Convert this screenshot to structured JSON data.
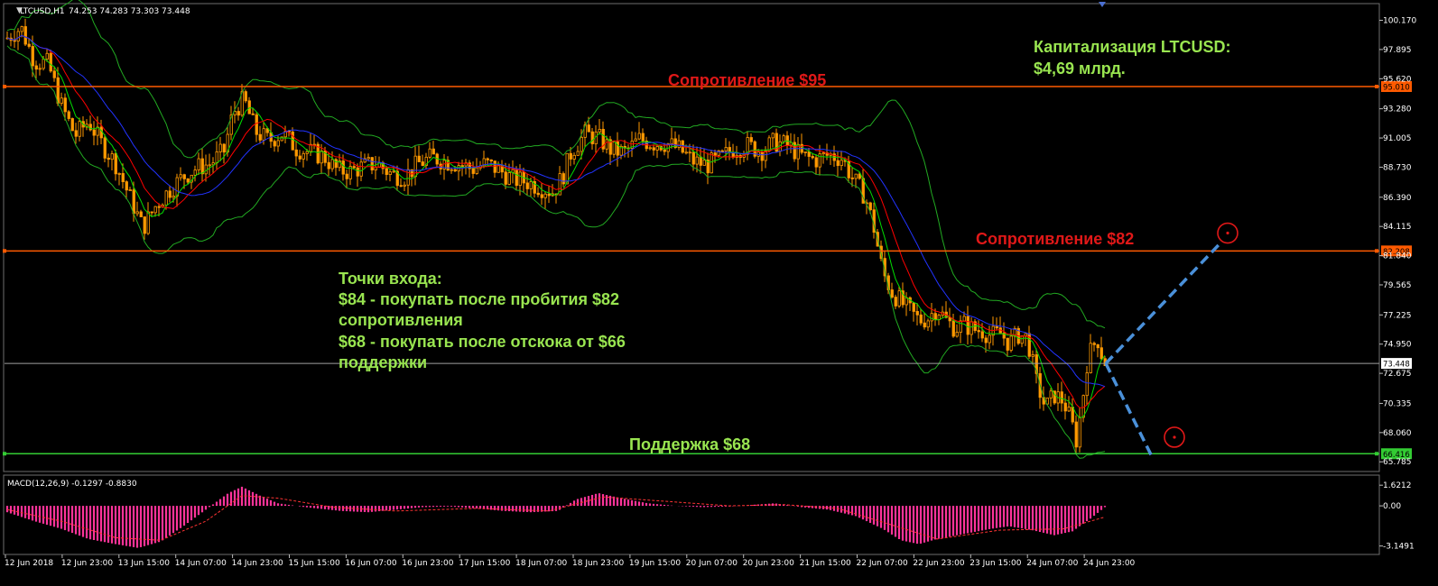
{
  "header": {
    "symbol": "LTCUSD,H1",
    "ohlc": "74.253 74.283 73.303 73.448"
  },
  "macd_header": {
    "label": "MACD(12,26,9) -0.1297 -0.8830"
  },
  "colors": {
    "background": "#000000",
    "candle": "#ff9900",
    "resistance_line": "#ff5a00",
    "support_line": "#33cc33",
    "price_line": "#a0a0a0",
    "bollinger": "#22aa22",
    "ma_fast": "#00dd00",
    "ma_red": "#ff0000",
    "ma_blue": "#2233ff",
    "macd_hist": "#ff3399",
    "macd_signal": "#ff3333",
    "projection": "#4a90d9",
    "annotation_green": "#99e550",
    "annotation_red": "#e01818"
  },
  "chart_data": {
    "type": "candlestick",
    "title": "",
    "y_ticks": [
      "100.170",
      "97.895",
      "95.620",
      "93.280",
      "91.005",
      "88.730",
      "86.390",
      "84.115",
      "81.840",
      "79.565",
      "77.225",
      "74.950",
      "72.675",
      "70.335",
      "68.060",
      "65.785"
    ],
    "x_ticks": [
      "12 Jun 2018",
      "12 Jun 23:00",
      "13 Jun 15:00",
      "14 Jun 07:00",
      "14 Jun 23:00",
      "15 Jun 15:00",
      "16 Jun 07:00",
      "16 Jun 23:00",
      "17 Jun 15:00",
      "18 Jun 07:00",
      "18 Jun 23:00",
      "19 Jun 15:00",
      "20 Jun 07:00",
      "20 Jun 23:00",
      "21 Jun 15:00",
      "22 Jun 07:00",
      "22 Jun 23:00",
      "23 Jun 15:00",
      "24 Jun 07:00",
      "24 Jun 23:00"
    ],
    "ylim": [
      65.1,
      101.4
    ],
    "levels": [
      {
        "name": "resistance-95",
        "value": 95.01,
        "label": "95.010"
      },
      {
        "name": "resistance-82",
        "value": 82.208,
        "label": "82.208"
      },
      {
        "name": "current-price",
        "value": 73.448,
        "label": "73.448"
      },
      {
        "name": "support-66",
        "value": 66.416,
        "label": "66.416"
      }
    ],
    "price_path": [
      [
        0,
        98.8
      ],
      [
        15,
        99.6
      ],
      [
        30,
        97.0
      ],
      [
        45,
        96.8
      ],
      [
        60,
        93.5
      ],
      [
        75,
        91.2
      ],
      [
        90,
        92.3
      ],
      [
        105,
        90.5
      ],
      [
        120,
        89.0
      ],
      [
        135,
        86.5
      ],
      [
        150,
        84.0
      ],
      [
        165,
        85.8
      ],
      [
        180,
        87.0
      ],
      [
        195,
        88.0
      ],
      [
        210,
        88.7
      ],
      [
        225,
        89.0
      ],
      [
        240,
        90.0
      ],
      [
        250,
        93.0
      ],
      [
        262,
        94.0
      ],
      [
        275,
        91.5
      ],
      [
        290,
        90.8
      ],
      [
        305,
        91.4
      ],
      [
        320,
        90.2
      ],
      [
        335,
        89.9
      ],
      [
        350,
        89.6
      ],
      [
        365,
        88.5
      ],
      [
        380,
        88.4
      ],
      [
        395,
        88.8
      ],
      [
        410,
        89.0
      ],
      [
        425,
        88.2
      ],
      [
        440,
        88.0
      ],
      [
        455,
        89.0
      ],
      [
        470,
        89.5
      ],
      [
        485,
        89.2
      ],
      [
        500,
        89.0
      ],
      [
        515,
        88.6
      ],
      [
        530,
        89.0
      ],
      [
        545,
        88.5
      ],
      [
        560,
        87.8
      ],
      [
        575,
        87.6
      ],
      [
        590,
        87.2
      ],
      [
        605,
        86.8
      ],
      [
        615,
        88.0
      ],
      [
        625,
        90.0
      ],
      [
        640,
        91.3
      ],
      [
        655,
        91.0
      ],
      [
        670,
        90.0
      ],
      [
        685,
        89.9
      ],
      [
        700,
        90.9
      ],
      [
        715,
        90.6
      ],
      [
        730,
        90.6
      ],
      [
        745,
        90.1
      ],
      [
        760,
        89.2
      ],
      [
        775,
        88.9
      ],
      [
        790,
        89.4
      ],
      [
        805,
        90.2
      ],
      [
        820,
        90.4
      ],
      [
        835,
        90.0
      ],
      [
        850,
        90.7
      ],
      [
        865,
        90.4
      ],
      [
        880,
        89.6
      ],
      [
        895,
        89.3
      ],
      [
        910,
        89.7
      ],
      [
        925,
        89.4
      ],
      [
        935,
        88.0
      ],
      [
        950,
        86.5
      ],
      [
        960,
        84.0
      ],
      [
        970,
        80.5
      ],
      [
        980,
        79.0
      ],
      [
        990,
        78.2
      ],
      [
        1000,
        77.5
      ],
      [
        1010,
        76.8
      ],
      [
        1020,
        77.0
      ],
      [
        1030,
        77.8
      ],
      [
        1040,
        76.8
      ],
      [
        1050,
        76.2
      ],
      [
        1060,
        76.5
      ],
      [
        1070,
        76.1
      ],
      [
        1080,
        76.0
      ],
      [
        1090,
        75.6
      ],
      [
        1100,
        75.8
      ],
      [
        1110,
        75.0
      ],
      [
        1120,
        75.7
      ],
      [
        1130,
        75.4
      ],
      [
        1140,
        72.0
      ],
      [
        1150,
        70.0
      ],
      [
        1160,
        71.0
      ],
      [
        1170,
        70.5
      ],
      [
        1178,
        69.0
      ],
      [
        1184,
        67.5
      ],
      [
        1190,
        70.0
      ],
      [
        1196,
        73.5
      ],
      [
        1202,
        74.8
      ],
      [
        1208,
        75.3
      ],
      [
        1214,
        73.7
      ],
      [
        1219,
        73.448
      ]
    ],
    "projections": [
      {
        "name": "bullish",
        "from": {
          "x": 1219,
          "y": 73.448
        },
        "to": {
          "x": 1347,
          "y": 82.9
        }
      },
      {
        "name": "bearish",
        "from": {
          "x": 1219,
          "y": 73.448
        },
        "to": {
          "x": 1270,
          "y": 66.2
        }
      }
    ],
    "targets": [
      {
        "name": "target-up",
        "x": 1354,
        "y": 83.6
      },
      {
        "name": "target-down",
        "x": 1295,
        "y": 67.7
      }
    ],
    "macd": {
      "ylim": [
        -3.6,
        2.2
      ],
      "ticks": [
        "1.6212",
        "0.00",
        "-3.1491"
      ],
      "hist_path": [
        [
          0,
          -0.5
        ],
        [
          30,
          -1.2
        ],
        [
          60,
          -1.8
        ],
        [
          90,
          -2.6
        ],
        [
          120,
          -3.0
        ],
        [
          145,
          -3.3
        ],
        [
          170,
          -2.8
        ],
        [
          195,
          -1.6
        ],
        [
          220,
          -0.3
        ],
        [
          245,
          1.0
        ],
        [
          260,
          1.5
        ],
        [
          280,
          0.8
        ],
        [
          300,
          0.2
        ],
        [
          330,
          -0.1
        ],
        [
          370,
          -0.4
        ],
        [
          400,
          -0.5
        ],
        [
          430,
          -0.3
        ],
        [
          460,
          -0.1
        ],
        [
          490,
          -0.05
        ],
        [
          520,
          -0.2
        ],
        [
          550,
          -0.4
        ],
        [
          580,
          -0.5
        ],
        [
          610,
          -0.4
        ],
        [
          630,
          0.5
        ],
        [
          655,
          1.0
        ],
        [
          680,
          0.6
        ],
        [
          710,
          0.2
        ],
        [
          740,
          0.0
        ],
        [
          770,
          -0.1
        ],
        [
          800,
          -0.05
        ],
        [
          830,
          0.1
        ],
        [
          850,
          0.2
        ],
        [
          880,
          -0.1
        ],
        [
          910,
          -0.3
        ],
        [
          940,
          -0.8
        ],
        [
          970,
          -1.8
        ],
        [
          990,
          -2.7
        ],
        [
          1010,
          -3.0
        ],
        [
          1030,
          -2.6
        ],
        [
          1060,
          -2.2
        ],
        [
          1090,
          -1.8
        ],
        [
          1110,
          -1.6
        ],
        [
          1135,
          -1.9
        ],
        [
          1160,
          -2.3
        ],
        [
          1180,
          -2.0
        ],
        [
          1200,
          -1.0
        ],
        [
          1216,
          -0.1
        ]
      ],
      "signal_path": [
        [
          0,
          -0.3
        ],
        [
          60,
          -1.2
        ],
        [
          120,
          -2.5
        ],
        [
          170,
          -2.7
        ],
        [
          220,
          -1.2
        ],
        [
          260,
          0.8
        ],
        [
          300,
          0.6
        ],
        [
          360,
          -0.1
        ],
        [
          430,
          -0.4
        ],
        [
          520,
          -0.2
        ],
        [
          600,
          -0.4
        ],
        [
          660,
          0.7
        ],
        [
          720,
          0.4
        ],
        [
          800,
          0.0
        ],
        [
          860,
          0.1
        ],
        [
          920,
          -0.2
        ],
        [
          980,
          -1.5
        ],
        [
          1030,
          -2.6
        ],
        [
          1100,
          -1.9
        ],
        [
          1170,
          -1.8
        ],
        [
          1216,
          -0.88
        ]
      ]
    }
  },
  "annotations": {
    "capitalization": [
      "Капитализация LTCUSD:",
      "$4,69 млрд."
    ],
    "resistance_95": "Сопротивление $95",
    "resistance_82": "Сопротивление $82",
    "support_68": "Поддержка $68",
    "entry_points": [
      "Точки входа:",
      "$84 - покупать после пробития $82",
      "сопротивления",
      "$68 - покупать после отскока от $66",
      "поддержки"
    ]
  }
}
